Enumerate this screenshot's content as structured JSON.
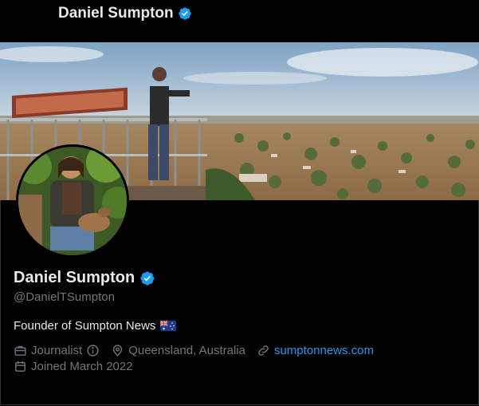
{
  "header": {
    "name": "Daniel Sumpton"
  },
  "profile": {
    "display_name": "Daniel Sumpton",
    "handle": "@DanielTSumpton",
    "bio": "Founder of Sumpton News",
    "bio_emoji": "australia-flag",
    "profession": "Journalist",
    "location": "Queensland, Australia",
    "website": "sumptonnews.com",
    "joined": "Joined March 2022"
  },
  "icons": {
    "verified": "verified-badge-icon",
    "profession": "briefcase-icon",
    "info": "info-icon",
    "location": "location-pin-icon",
    "website": "link-icon",
    "joined": "calendar-icon"
  },
  "colors": {
    "background": "#000000",
    "accent": "#1d9bf0",
    "secondary_text": "#71767b",
    "primary_text": "#e7e9ea"
  }
}
